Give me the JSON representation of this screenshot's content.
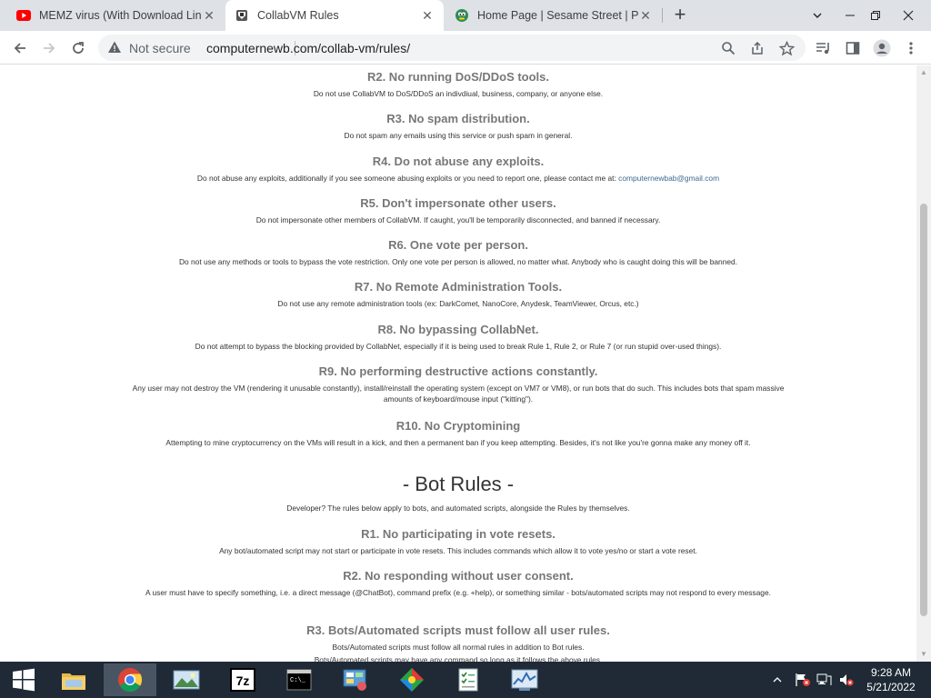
{
  "browser": {
    "tabs": [
      {
        "title": "MEMZ virus (With Download Link",
        "favicon": "youtube-icon",
        "active": false
      },
      {
        "title": "CollabVM Rules",
        "favicon": "collabvm-icon",
        "active": true
      },
      {
        "title": "Home Page | Sesame Street | PBS",
        "favicon": "pbs-kids-icon",
        "active": false
      }
    ],
    "new_tab": "+",
    "security_label": "Not secure",
    "url": "computernewb.com/collab-vm/rules/"
  },
  "rules": [
    {
      "title": "R2. No running DoS/DDoS tools.",
      "text": "Do not use CollabVM to DoS/DDoS an indivdiual, business, company, or anyone else."
    },
    {
      "title": "R3. No spam distribution.",
      "text": "Do not spam any emails using this service or push spam in general."
    },
    {
      "title": "R4. Do not abuse any exploits.",
      "text": "Do not abuse any exploits, additionally if you see someone abusing exploits or you need to report one, please contact me at: ",
      "link": "computernewbab@gmail.com"
    },
    {
      "title": "R5. Don't impersonate other users.",
      "text": "Do not impersonate other members of CollabVM. If caught, you'll be temporarily disconnected, and banned if necessary."
    },
    {
      "title": "R6. One vote per person.",
      "text": "Do not use any methods or tools to bypass the vote restriction. Only one vote per person is allowed, no matter what. Anybody who is caught doing this will be banned."
    },
    {
      "title": "R7. No Remote Administration Tools.",
      "text": "Do not use any remote administration tools (ex: DarkComet, NanoCore, Anydesk, TeamViewer, Orcus, etc.)"
    },
    {
      "title": "R8. No bypassing CollabNet.",
      "text": "Do not attempt to bypass the blocking provided by CollabNet, especially if it is being used to break Rule 1, Rule 2, or Rule 7 (or run stupid over-used things)."
    },
    {
      "title": "R9. No performing destructive actions constantly.",
      "text": "Any user may not destroy the VM (rendering it unusable constantly), install/reinstall the operating system (except on VM7 or VM8), or run bots that do such. This includes bots that spam massive amounts of keyboard/mouse input (\"kitting\")."
    },
    {
      "title": "R10. No Cryptomining",
      "text": "Attempting to mine cryptocurrency on the VMs will result in a kick, and then a permanent ban if you keep attempting. Besides, it's not like you're gonna make any money off it."
    }
  ],
  "bot_section": {
    "title": "- Bot Rules -",
    "description": "Developer? The rules below apply to bots, and automated scripts, alongside the Rules by themselves."
  },
  "bot_rules": [
    {
      "title": "R1. No participating in vote resets.",
      "text": "Any bot/automated script may not start or participate in vote resets. This includes commands which allow it to vote yes/no or start a vote reset."
    },
    {
      "title": "R2. No responding without user consent.",
      "text": "A user must have to specify something, i.e. a direct message (@ChatBot), command prefix (e.g. +help), or something similar - bots/automated scripts may not respond to every message."
    },
    {
      "title": "R3. Bots/Automated scripts must follow all user rules.",
      "text": "Bots/Automated scripts must follow all normal rules in addition to Bot rules.",
      "text2": "Bots/Automated scripts may have any command so long as it follows the above rules."
    }
  ],
  "taskbar": {
    "time": "9:28 AM",
    "date": "5/21/2022",
    "apps": [
      "file-explorer-icon",
      "chrome-icon",
      "photo-viewer-icon",
      "7zip-icon",
      "command-prompt-icon",
      "control-panel-icon",
      "colorful-app-icon",
      "task-list-icon",
      "performance-monitor-icon"
    ]
  }
}
